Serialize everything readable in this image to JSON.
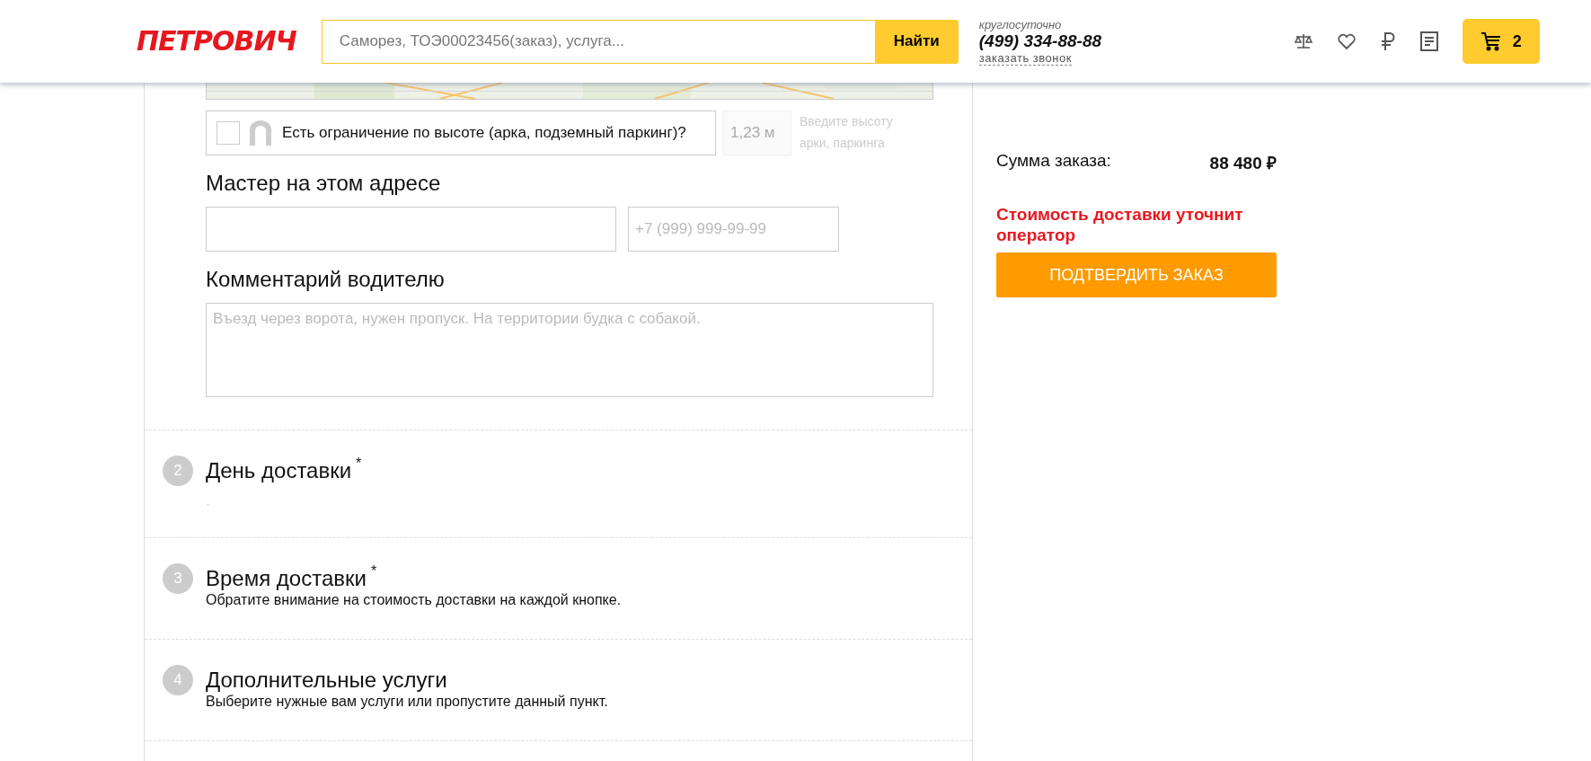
{
  "header": {
    "logo": "ПЕТРОВИЧ",
    "search": {
      "placeholder": "Саморез, ТОЭ00023456(заказ), услуга..."
    },
    "search_button": "Найти",
    "phone_caption": "круглосуточно",
    "phone": "(499) 334-88-88",
    "callback_link": "заказать звонок",
    "cart_count": "2"
  },
  "address": {
    "height_limit": {
      "checked": false,
      "label": "Есть ограничение по высоте (арка, подземный паркинг)?",
      "value_placeholder": "1,23 м",
      "hint": "Введите высоту арки, паркинга"
    },
    "master_title": "Мастер на этом адресе",
    "master_phone_placeholder": "+7 (999) 999-99-99",
    "comment_title": "Комментарий водителю",
    "comment_placeholder": "Въезд через ворота, нужен пропуск. На территории будка с собакой."
  },
  "steps": [
    {
      "number": "2",
      "title": "День доставки",
      "required_mark": "*",
      "note": "."
    },
    {
      "number": "3",
      "title": "Время доставки",
      "required_mark": "*",
      "subtitle": "Обратите внимание на стоимость доставки на каждой кнопке."
    },
    {
      "number": "4",
      "title": "Дополнительные услуги",
      "subtitle": "Выберите нужные вам услуги или пропустите данный пункт."
    }
  ],
  "summary": {
    "label": "Сумма заказа:",
    "total": "88 480 ₽",
    "delivery_notice": "Стоимость доставки уточнит оператор",
    "confirm_button": "ПОДТВЕРДИТЬ ЗАКАЗ"
  }
}
